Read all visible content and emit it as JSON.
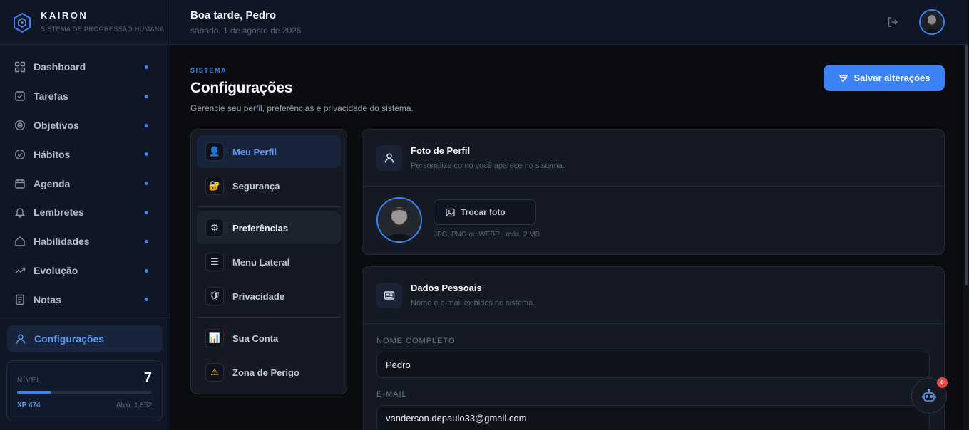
{
  "brand": {
    "name": "KAIRON",
    "tagline": "SISTEMA DE PROGRESSÃO HUMANA",
    "icon": "hexagon-logo-icon"
  },
  "sidebar": {
    "items": [
      {
        "label": "Dashboard",
        "icon": "grid-icon"
      },
      {
        "label": "Tarefas",
        "icon": "checkbox-icon"
      },
      {
        "label": "Objetivos",
        "icon": "target-icon"
      },
      {
        "label": "Hábitos",
        "icon": "check-circle-icon"
      },
      {
        "label": "Agenda",
        "icon": "calendar-icon"
      },
      {
        "label": "Lembretes",
        "icon": "bell-icon"
      },
      {
        "label": "Habilidades",
        "icon": "home-icon"
      },
      {
        "label": "Evolução",
        "icon": "trend-up-icon"
      },
      {
        "label": "Notas",
        "icon": "note-icon"
      }
    ],
    "active": {
      "label": "Configurações",
      "icon": "user-icon"
    },
    "level": {
      "label": "NÍVEL",
      "value": "7",
      "xp": "XP 474",
      "goal": "Alvo: 1,852",
      "progress": 0.256
    }
  },
  "header": {
    "greeting": "Boa tarde, Pedro",
    "date": "sábado, 1 de agosto de 2026"
  },
  "page": {
    "eyebrow": "SISTEMA",
    "title": "Configurações",
    "subtitle": "Gerencie seu perfil, preferências e privacidade do sistema.",
    "save_label": "Salvar alterações"
  },
  "settings_nav": [
    {
      "label": "Meu Perfil",
      "icon": "👤",
      "state": "active"
    },
    {
      "label": "Segurança",
      "icon": "🔐",
      "state": ""
    },
    {
      "label": "Preferências",
      "icon": "⚙",
      "state": "hover"
    },
    {
      "label": "Menu Lateral",
      "icon": "☰",
      "state": ""
    },
    {
      "label": "Privacidade",
      "icon": "🛡",
      "state": ""
    },
    {
      "label": "Sua Conta",
      "icon": "📊",
      "state": ""
    },
    {
      "label": "Zona de Perigo",
      "icon": "⚠",
      "state": ""
    }
  ],
  "photo_card": {
    "title": "Foto de Perfil",
    "subtitle": "Personalize como você aparece no sistema.",
    "change_label": "Trocar foto",
    "hint": "JPG, PNG ou WEBP · máx. 2 MB"
  },
  "personal_card": {
    "title": "Dados Pessoais",
    "subtitle": "Nome e e-mail exibidos no sistema.",
    "name_label": "NOME COMPLETO",
    "name_value": "Pedro",
    "email_label": "E-MAIL",
    "email_value": "vanderson.depaulo33@gmail.com"
  },
  "assistant": {
    "badge": "0"
  },
  "colors": {
    "accent": "#3b82f6",
    "sidebar_bg": "#0f1625",
    "page_bg": "#0b0c0f",
    "card_bg": "#141923",
    "danger": "#ef4444"
  }
}
